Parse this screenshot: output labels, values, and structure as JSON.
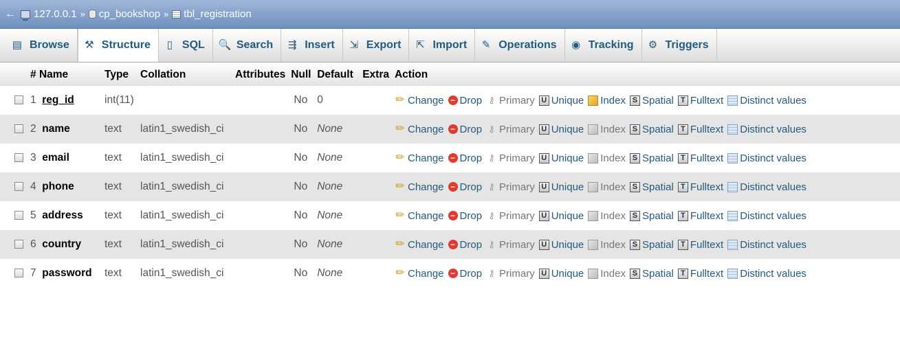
{
  "breadcrumb": {
    "back_glyph": "←",
    "server": "127.0.0.1",
    "database": "cp_bookshop",
    "table": "tbl_registration",
    "separator": "»"
  },
  "tabs": [
    {
      "label": "Browse",
      "icon": "browse-icon",
      "glyph": "▤"
    },
    {
      "label": "Structure",
      "icon": "structure-icon",
      "glyph": "⚒",
      "active": true
    },
    {
      "label": "SQL",
      "icon": "sql-icon",
      "glyph": "▯"
    },
    {
      "label": "Search",
      "icon": "search-icon",
      "glyph": "🔍"
    },
    {
      "label": "Insert",
      "icon": "insert-icon",
      "glyph": "⇶"
    },
    {
      "label": "Export",
      "icon": "export-icon",
      "glyph": "⇲"
    },
    {
      "label": "Import",
      "icon": "import-icon",
      "glyph": "⇱"
    },
    {
      "label": "Operations",
      "icon": "wrench-icon",
      "glyph": "✎"
    },
    {
      "label": "Tracking",
      "icon": "tracking-icon",
      "glyph": "◉"
    },
    {
      "label": "Triggers",
      "icon": "triggers-icon",
      "glyph": "⚙"
    }
  ],
  "columns": {
    "num": "#",
    "name": "Name",
    "type": "Type",
    "collation": "Collation",
    "attributes": "Attributes",
    "null": "Null",
    "default": "Default",
    "extra": "Extra",
    "action": "Action"
  },
  "rows": [
    {
      "num": "1",
      "name": "reg_id",
      "type": "int(11)",
      "collation": "",
      "null": "No",
      "default": "0",
      "primary": true
    },
    {
      "num": "2",
      "name": "name",
      "type": "text",
      "collation": "latin1_swedish_ci",
      "null": "No",
      "default": "None"
    },
    {
      "num": "3",
      "name": "email",
      "type": "text",
      "collation": "latin1_swedish_ci",
      "null": "No",
      "default": "None"
    },
    {
      "num": "4",
      "name": "phone",
      "type": "text",
      "collation": "latin1_swedish_ci",
      "null": "No",
      "default": "None"
    },
    {
      "num": "5",
      "name": "address",
      "type": "text",
      "collation": "latin1_swedish_ci",
      "null": "No",
      "default": "None"
    },
    {
      "num": "6",
      "name": "country",
      "type": "text",
      "collation": "latin1_swedish_ci",
      "null": "No",
      "default": "None"
    },
    {
      "num": "7",
      "name": "password",
      "type": "text",
      "collation": "latin1_swedish_ci",
      "null": "No",
      "default": "None"
    }
  ],
  "actions": {
    "change": "Change",
    "drop": "Drop",
    "primary": "Primary",
    "unique": "Unique",
    "index": "Index",
    "spatial": "Spatial",
    "fulltext": "Fulltext",
    "distinct": "Distinct values"
  }
}
